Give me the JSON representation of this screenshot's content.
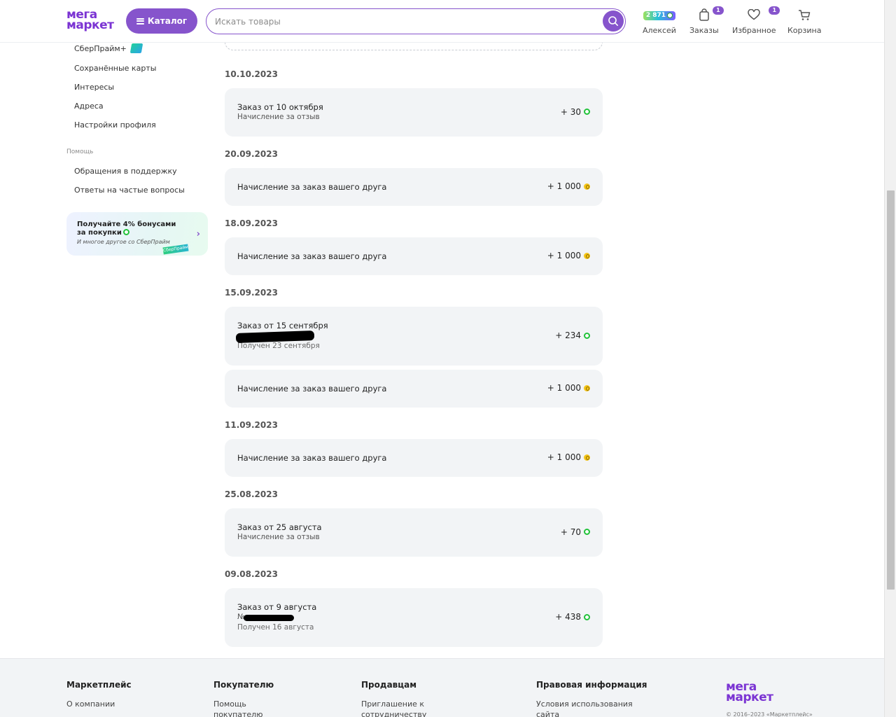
{
  "header": {
    "logo_line1": "мега",
    "logo_line2": "маркет",
    "catalog_label": "Каталог",
    "search_placeholder": "Искать товары",
    "bonus_balance": "2 871",
    "user_label": "Алексей",
    "orders_label": "Заказы",
    "orders_count": "1",
    "favorites_label": "Избранное",
    "favorites_count": "1",
    "cart_label": "Корзина"
  },
  "sidebar": {
    "links_top": [
      "СберПрайм+",
      "Сохранённые карты",
      "Интересы",
      "Адреса",
      "Настройки профиля"
    ],
    "help_title": "Помощь",
    "help_links": [
      "Обращения в поддержку",
      "Ответы на частые вопросы"
    ],
    "promo": {
      "title": "Получайте 4% бонусами за покупки",
      "subtitle": "И многое другое со СберПрайм",
      "ribbon": "СберПрайм"
    }
  },
  "history": [
    {
      "date": "10.10.2023",
      "items": [
        {
          "title": "Заказ от 10 октября",
          "sub": "Начисление за отзыв",
          "amount": "+ 30",
          "coin": "green"
        }
      ]
    },
    {
      "date": "20.09.2023",
      "items": [
        {
          "title": "Начисление за заказ вашего друга",
          "amount": "+ 1 000",
          "coin": "yellow"
        }
      ]
    },
    {
      "date": "18.09.2023",
      "items": [
        {
          "title": "Начисление за заказ вашего друга",
          "amount": "+ 1 000",
          "coin": "yellow"
        }
      ]
    },
    {
      "date": "15.09.2023",
      "items": [
        {
          "title": "Заказ от 15 сентября",
          "sub2": "Получен 23 сентября",
          "amount": "+ 234",
          "coin": "green"
        },
        {
          "title": "Начисление за заказ вашего друга",
          "amount": "+ 1 000",
          "coin": "yellow"
        }
      ]
    },
    {
      "date": "11.09.2023",
      "items": [
        {
          "title": "Начисление за заказ вашего друга",
          "amount": "+ 1 000",
          "coin": "yellow"
        }
      ]
    },
    {
      "date": "25.08.2023",
      "items": [
        {
          "title": "Заказ от 25 августа",
          "sub": "Начисление за отзыв",
          "amount": "+ 70",
          "coin": "green"
        }
      ]
    },
    {
      "date": "09.08.2023",
      "items": [
        {
          "title": "Заказ от 9 августа",
          "sub": "№",
          "sub2": "Получен 16 августа",
          "amount": "+ 438",
          "coin": "green"
        }
      ]
    }
  ],
  "footer": {
    "col1_title": "Маркетплейс",
    "col1_link": "О компании",
    "col2_title": "Покупателю",
    "col2_link": "Помощь покупателю",
    "col3_title": "Продавцам",
    "col3_link": "Приглашение к сотрудничеству",
    "col4_title": "Правовая информация",
    "col4_link": "Условия использования сайта",
    "copyright": "© 2016–2023 «Маркетплейс»"
  }
}
